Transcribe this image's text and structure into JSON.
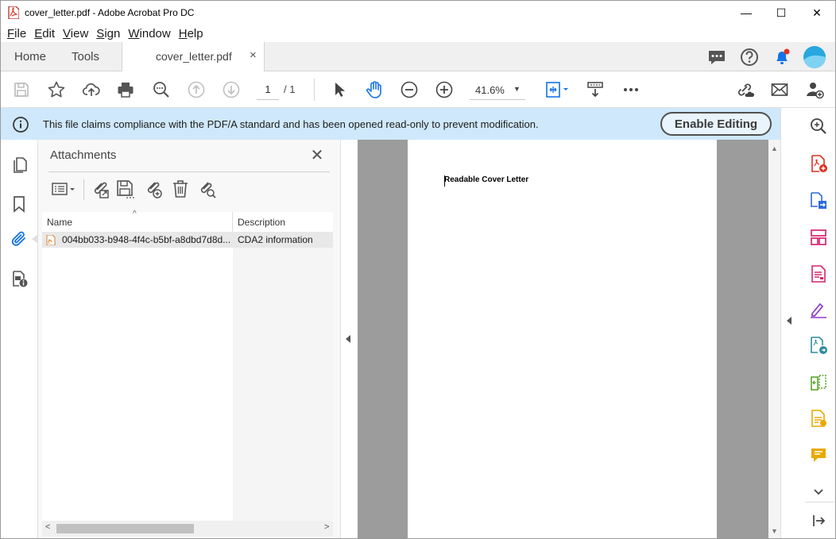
{
  "window": {
    "title": "cover_letter.pdf - Adobe Acrobat Pro DC",
    "controls": {
      "minimize": "—",
      "maximize": "☐",
      "close": "✕"
    }
  },
  "menu": [
    {
      "key": "F",
      "rest": "ile"
    },
    {
      "key": "E",
      "rest": "dit"
    },
    {
      "key": "V",
      "rest": "iew"
    },
    {
      "key": "S",
      "rest": "ign"
    },
    {
      "key": "W",
      "rest": "indow"
    },
    {
      "key": "H",
      "rest": "elp"
    }
  ],
  "tabs": {
    "home": "Home",
    "tools": "Tools",
    "document": "cover_letter.pdf",
    "document_close": "×"
  },
  "toolbar": {
    "page_current": "1",
    "page_total": "/ 1",
    "zoom": "41.6%"
  },
  "notice": {
    "message": "This file claims compliance with the PDF/A standard and has been opened read-only to prevent modification.",
    "button": "Enable Editing"
  },
  "attachments": {
    "title": "Attachments",
    "close": "✕",
    "columns": {
      "name": "Name",
      "description": "Description"
    },
    "rows": [
      {
        "name": "004bb033-b948-4f4c-b5bf-a8dbd7d8d...",
        "description": "CDA2 information"
      }
    ]
  },
  "document": {
    "text": "Readable Cover Letter"
  },
  "colors": {
    "acrobat_red": "#e0301e",
    "notice_bg": "#cfe8fb",
    "accent_blue": "#1473e6"
  }
}
